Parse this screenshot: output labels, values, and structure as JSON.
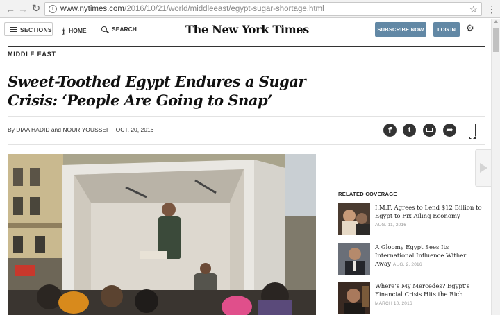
{
  "browser": {
    "url_host": "www.nytimes.com",
    "url_path": "/2016/10/21/world/middleeast/egypt-sugar-shortage.html"
  },
  "header": {
    "sections_label": "SECTIONS",
    "home_label": "HOME",
    "search_label": "SEARCH",
    "logo_text": "The New York Times",
    "subscribe_label": "SUBSCRIBE NOW",
    "login_label": "LOG IN"
  },
  "article": {
    "kicker": "MIDDLE EAST",
    "headline": "Sweet-Toothed Egypt Endures a Sugar Crisis: ‘People Are Going to Snap’",
    "byline": "By DIAA HADID and NOUR YOUSSEF",
    "date": "OCT. 20, 2016"
  },
  "share": {
    "facebook_glyph": "f",
    "twitter_glyph": "t",
    "more_glyph": "➦"
  },
  "related": {
    "heading": "RELATED COVERAGE",
    "items": [
      {
        "title": "I.M.F. Agrees to Lend $12 Billion to Egypt to Fix Ailing Economy",
        "date": "AUG. 11, 2016"
      },
      {
        "title": "A Gloomy Egypt Sees Its International Influence Wither Away",
        "date": "AUG. 2, 2016"
      },
      {
        "title": "Where’s My Mercedes? Egypt’s Financial Crisis Hits the Rich",
        "date": "MARCH 10, 2016"
      }
    ]
  },
  "colors": {
    "button_blue": "#6288a5",
    "truck_white": "#e9e7e2",
    "sky": "#c9cfd3"
  }
}
